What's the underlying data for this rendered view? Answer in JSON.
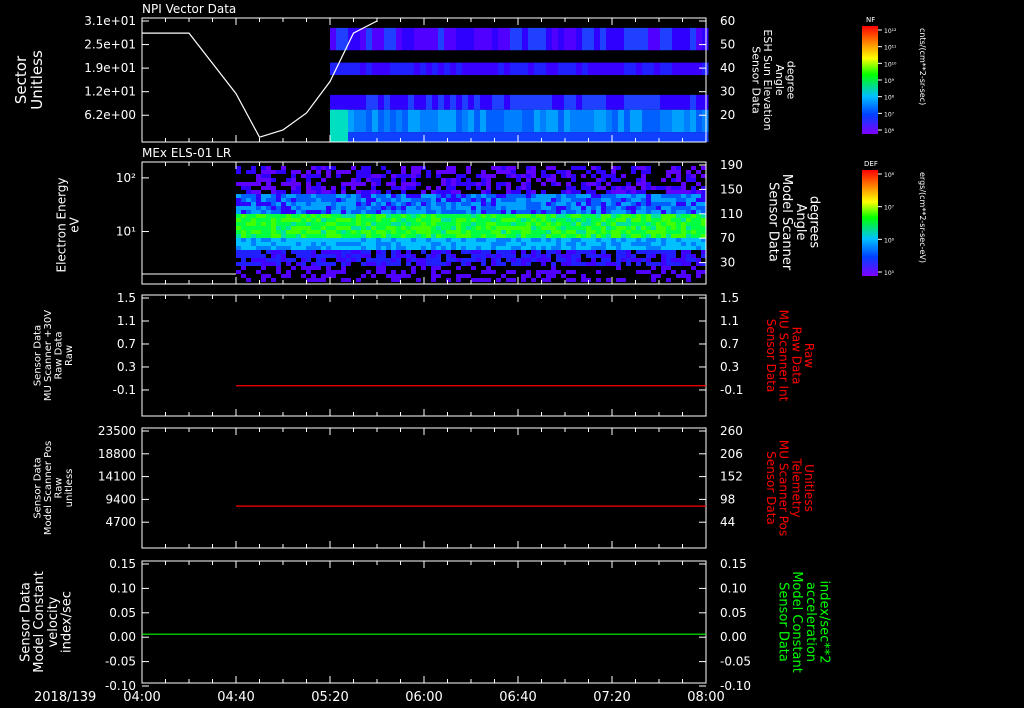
{
  "time_axis": {
    "date_label": "2018/139",
    "ticks": [
      "04:00",
      "04:40",
      "05:20",
      "06:00",
      "06:40",
      "07:20",
      "08:00"
    ]
  },
  "colors": {
    "background": "#000000",
    "axis": "#ffffff",
    "red_trace": "#ff0000",
    "green_trace": "#00ff00"
  },
  "colorbars": [
    {
      "label": "NF",
      "units": "cnts/(cm**2-sr-sec)",
      "ticks": [
        "10¹²",
        "10¹¹",
        "10¹⁰",
        "10⁹",
        "10⁸",
        "10⁷",
        "10⁶"
      ]
    },
    {
      "label": "DEF",
      "units": "ergs/(cm**2-sr-sec-eV)",
      "ticks": [
        "10⁸",
        "10⁷",
        "10⁶",
        "10⁵"
      ]
    }
  ],
  "chart_data": [
    {
      "type": "heatmap",
      "title": "NPI Vector Data",
      "ylabel": [
        "Sector",
        "Unitless"
      ],
      "yticks": [
        "3.1e+01",
        "2.5e+01",
        "1.9e+01",
        "1.2e+01",
        "6.2e+00"
      ],
      "y2label": [
        "Sensor Data",
        "ESH Sun Elevation",
        "Angle",
        "degree"
      ],
      "y2ticks": [
        "60",
        "50",
        "40",
        "30",
        "20"
      ],
      "data_start": "05:20",
      "overlay_line": {
        "name": "ESH Sun Elevation Angle",
        "color": "#ffffff",
        "times": [
          "04:00",
          "04:20",
          "04:40",
          "04:50",
          "05:00",
          "05:10",
          "05:20",
          "05:30",
          "05:40"
        ],
        "values": [
          55,
          55,
          30,
          12,
          15,
          22,
          35,
          55,
          60
        ]
      }
    },
    {
      "type": "heatmap",
      "title": "MEx ELS-01 LR",
      "ylabel": [
        "Electron Energy",
        "eV"
      ],
      "yticks": [
        "10²",
        "10¹"
      ],
      "y2label": [
        "Sensor Data",
        "Model Scanner",
        "Angle",
        "degrees"
      ],
      "y2ticks": [
        "190",
        "150",
        "110",
        "70",
        "30"
      ],
      "data_start": "04:40"
    },
    {
      "type": "line",
      "ylabel": [
        "Sensor Data",
        "MU Scanner +30V",
        "Raw Data",
        "Raw"
      ],
      "yticks": [
        "1.5",
        "1.1",
        "0.7",
        "0.3",
        "-0.1"
      ],
      "ylim": [
        -0.5,
        1.5
      ],
      "y2label": [
        "Sensor Data",
        "MU Scanner Int",
        "Raw Data",
        "Raw"
      ],
      "y2ticks": [
        "1.5",
        "1.1",
        "0.7",
        "0.3",
        "-0.1"
      ],
      "series": [
        {
          "name": "MU Scanner Int Raw Data",
          "color": "#ff0000",
          "x": [
            "04:40",
            "08:00"
          ],
          "values": [
            0,
            0
          ]
        }
      ]
    },
    {
      "type": "line",
      "ylabel": [
        "Sensor Data",
        "Model Scanner Pos",
        "Raw",
        "unitless"
      ],
      "yticks": [
        "23500",
        "18800",
        "14100",
        "9400",
        "4700"
      ],
      "ylim": [
        0,
        23500
      ],
      "y2label": [
        "Sensor Data",
        "MU Scanner Pos",
        "Telemetry",
        "Unitless"
      ],
      "y2ticks": [
        "260",
        "206",
        "152",
        "98",
        "44"
      ],
      "series": [
        {
          "name": "MU Scanner Pos Telemetry",
          "color": "#ff0000",
          "x": [
            "04:40",
            "08:00"
          ],
          "values": [
            8200,
            8200
          ]
        }
      ]
    },
    {
      "type": "line",
      "ylabel": [
        "Sensor Data",
        "Model Constant",
        "velocity",
        "index/sec"
      ],
      "yticks": [
        "0.15",
        "0.10",
        "0.05",
        "0.00",
        "-0.05",
        "-0.10"
      ],
      "ylim": [
        -0.1,
        0.15
      ],
      "y2label": [
        "Sensor Data",
        "Model Constant",
        "acceleration",
        "index/sec**2"
      ],
      "y2ticks": [
        "0.15",
        "0.10",
        "0.05",
        "0.00",
        "-0.05",
        "-0.10"
      ],
      "series": [
        {
          "name": "Model Constant acceleration",
          "color": "#00ff00",
          "x": [
            "04:00",
            "08:00"
          ],
          "values": [
            0,
            0
          ]
        }
      ]
    }
  ]
}
